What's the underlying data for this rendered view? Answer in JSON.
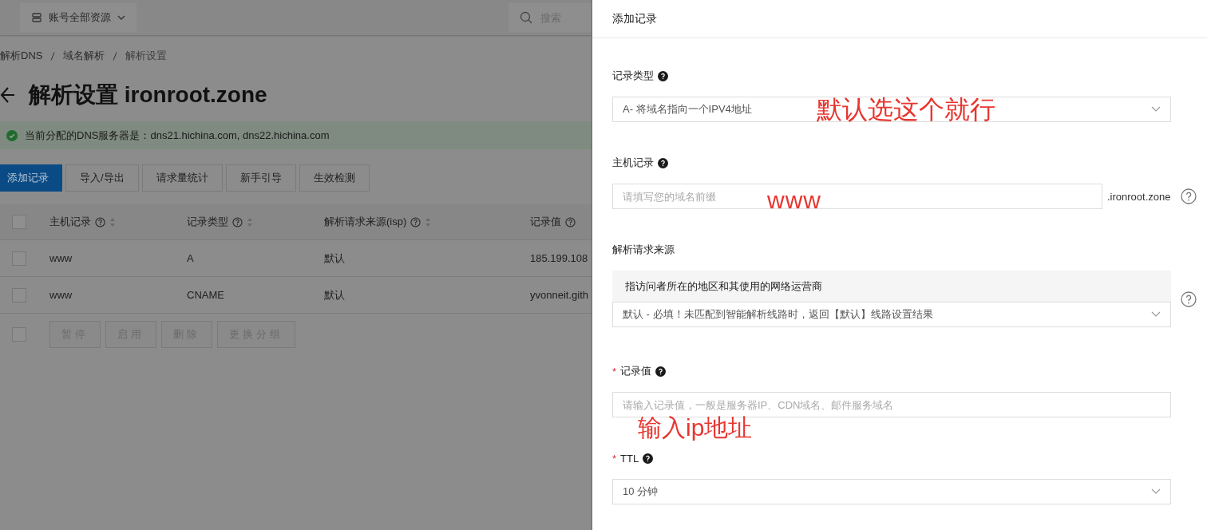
{
  "topbar": {
    "resource_selector": "账号全部资源",
    "search": {
      "placeholder": "搜索"
    }
  },
  "breadcrumb": [
    "解析DNS",
    "域名解析",
    "解析设置"
  ],
  "page_title": "解析设置 ironroot.zone",
  "alert": {
    "kind": "success",
    "text": "当前分配的DNS服务器是：dns21.hichina.com, dns22.hichina.com"
  },
  "toolbar": [
    {
      "label": "添加记录",
      "kind": "primary"
    },
    {
      "label": "导入/导出",
      "kind": "default"
    },
    {
      "label": "请求量统计",
      "kind": "default"
    },
    {
      "label": "新手引导",
      "kind": "default"
    },
    {
      "label": "生效检测",
      "kind": "default"
    }
  ],
  "table": {
    "columns": [
      {
        "label": "主机记录",
        "help": true,
        "sortable": true
      },
      {
        "label": "记录类型",
        "help": true,
        "sortable": true
      },
      {
        "label": "解析请求来源(isp)",
        "help": true,
        "sortable": true
      },
      {
        "label": "记录值",
        "help": true,
        "sortable": false
      }
    ],
    "header_checked": false,
    "bulk_checked": false,
    "rows": [
      {
        "checked": false,
        "cells": [
          "www",
          "A",
          "默认",
          "185.199.108"
        ]
      },
      {
        "checked": false,
        "cells": [
          "www",
          "CNAME",
          "默认",
          "yvonneit.gith"
        ]
      }
    ],
    "bulk_actions": [
      {
        "label": "暂停",
        "disabled": true
      },
      {
        "label": "启用",
        "disabled": true
      },
      {
        "label": "删除",
        "disabled": true
      },
      {
        "label": "更换分组",
        "disabled": true
      }
    ]
  },
  "drawer": {
    "title": "添加记录",
    "fields": [
      {
        "kind": "select",
        "label": "记录类型",
        "label_help": true,
        "side_help": false,
        "value": "A- 将域名指向一个IPV4地址",
        "annotation": "默认选这个就行"
      },
      {
        "kind": "input",
        "label": "主机记录",
        "label_help": true,
        "side_help": true,
        "placeholder": "请填写您的域名前缀",
        "suffix": ".ironroot.zone",
        "annotation": "www"
      },
      {
        "kind": "select",
        "label": "解析请求来源",
        "label_help": false,
        "side_help": true,
        "hint": "指访问者所在的地区和其使用的网络运营商",
        "value": "默认 - 必填！未匹配到智能解析线路时，返回【默认】线路设置结果"
      },
      {
        "kind": "input",
        "label": "记录值",
        "required_mark": "*",
        "label_help": true,
        "side_help": false,
        "placeholder": "请输入记录值，一般是服务器IP、CDN域名、邮件服务域名",
        "annotation": "输入ip地址"
      },
      {
        "kind": "select",
        "label": "TTL",
        "required_mark": "*",
        "label_help": true,
        "side_help": false,
        "value": "10 分钟"
      }
    ]
  }
}
